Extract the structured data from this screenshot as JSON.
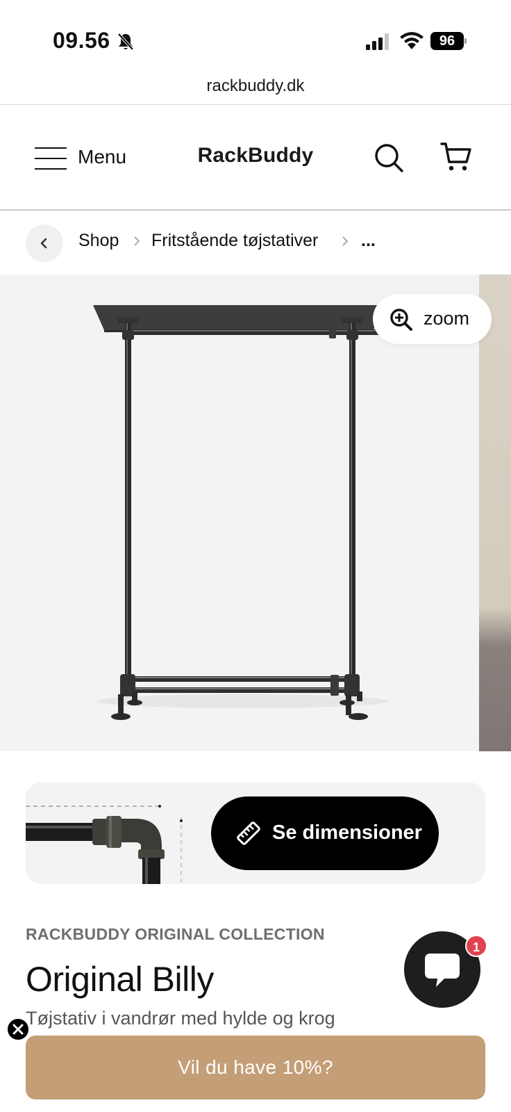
{
  "status_bar": {
    "time": "09.56",
    "battery": "96"
  },
  "browser": {
    "url": "rackbuddy.dk"
  },
  "header": {
    "menu_label": "Menu",
    "logo": "RackBuddy"
  },
  "breadcrumb": {
    "items": [
      "Shop",
      "Fritstående tøjstativer",
      "..."
    ]
  },
  "gallery": {
    "zoom_label": "zoom"
  },
  "dimensions": {
    "button_label": "Se dimensioner"
  },
  "product": {
    "collection": "RACKBUDDY ORIGINAL COLLECTION",
    "title": "Original Billy",
    "subtitle": "Tøjstativ i vandrør med hylde og krog"
  },
  "chat": {
    "badge_count": "1"
  },
  "promo": {
    "label": "Vil du have 10%?"
  },
  "colors": {
    "promo_bg": "#c49e76",
    "badge": "#e0424f",
    "button_dark": "#000000"
  }
}
